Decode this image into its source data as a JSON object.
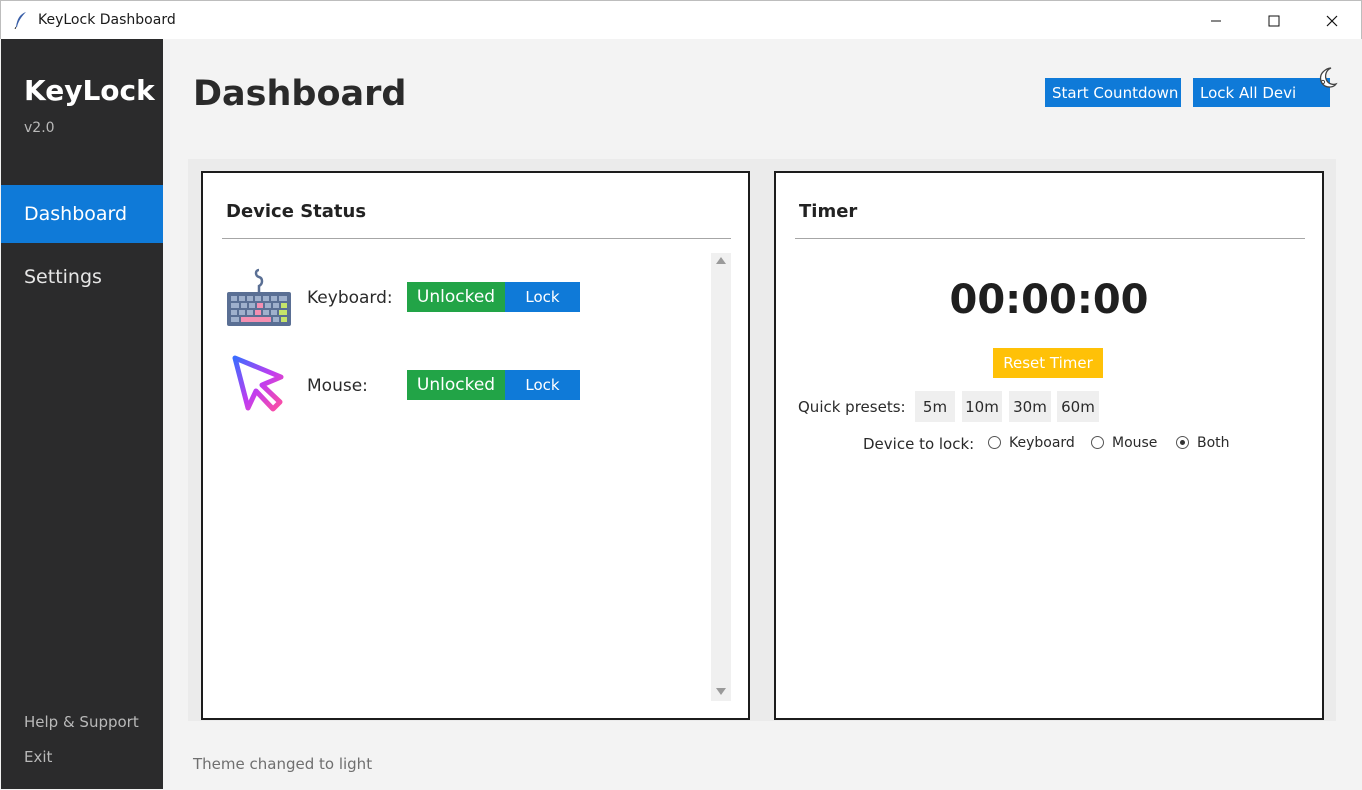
{
  "window": {
    "title": "KeyLock Dashboard"
  },
  "sidebar": {
    "brand": "KeyLock",
    "version": "v2.0",
    "items": [
      {
        "label": "Dashboard",
        "active": true
      },
      {
        "label": "Settings",
        "active": false
      }
    ],
    "help": "Help & Support",
    "exit": "Exit"
  },
  "header": {
    "title": "Dashboard",
    "start_countdown": "Start Countdown",
    "lock_all": "Lock All Devi",
    "theme_icon": "moon-icon"
  },
  "device_panel": {
    "title": "Device Status",
    "devices": [
      {
        "label": "Keyboard:",
        "status": "Unlocked",
        "action": "Lock",
        "icon": "keyboard-icon"
      },
      {
        "label": "Mouse:",
        "status": "Unlocked",
        "action": "Lock",
        "icon": "mouse-pointer-icon"
      }
    ]
  },
  "timer_panel": {
    "title": "Timer",
    "display": "00:00:00",
    "reset": "Reset Timer",
    "presets_label": "Quick presets:",
    "presets": [
      "5m",
      "10m",
      "30m",
      "60m"
    ],
    "device_label": "Device to lock:",
    "options": [
      {
        "label": "Keyboard",
        "checked": false
      },
      {
        "label": "Mouse",
        "checked": false
      },
      {
        "label": "Both",
        "checked": true
      }
    ]
  },
  "status_bar": {
    "text": "Theme changed to light"
  },
  "colors": {
    "sidebar_bg": "#2b2b2c",
    "accent_blue": "#0f7ad8",
    "unlocked_green": "#22a447",
    "reset_yellow": "#ffc107"
  }
}
